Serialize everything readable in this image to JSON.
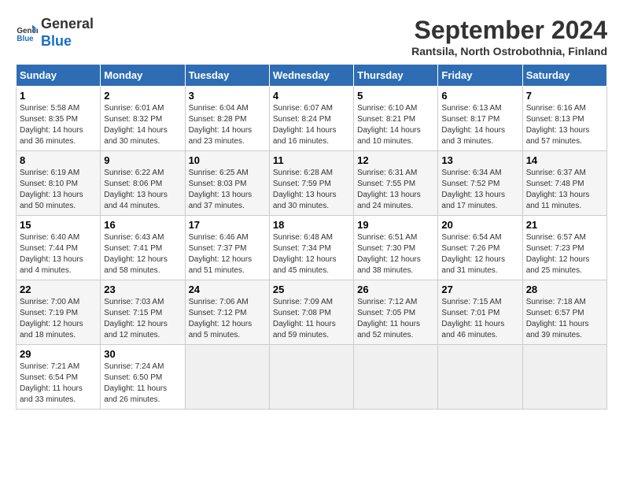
{
  "header": {
    "logo_line1": "General",
    "logo_line2": "Blue",
    "title": "September 2024",
    "subtitle": "Rantsila, North Ostrobothnia, Finland"
  },
  "days_of_week": [
    "Sunday",
    "Monday",
    "Tuesday",
    "Wednesday",
    "Thursday",
    "Friday",
    "Saturday"
  ],
  "weeks": [
    [
      {
        "day": "1",
        "sunrise": "Sunrise: 5:58 AM",
        "sunset": "Sunset: 8:35 PM",
        "daylight": "Daylight: 14 hours and 36 minutes."
      },
      {
        "day": "2",
        "sunrise": "Sunrise: 6:01 AM",
        "sunset": "Sunset: 8:32 PM",
        "daylight": "Daylight: 14 hours and 30 minutes."
      },
      {
        "day": "3",
        "sunrise": "Sunrise: 6:04 AM",
        "sunset": "Sunset: 8:28 PM",
        "daylight": "Daylight: 14 hours and 23 minutes."
      },
      {
        "day": "4",
        "sunrise": "Sunrise: 6:07 AM",
        "sunset": "Sunset: 8:24 PM",
        "daylight": "Daylight: 14 hours and 16 minutes."
      },
      {
        "day": "5",
        "sunrise": "Sunrise: 6:10 AM",
        "sunset": "Sunset: 8:21 PM",
        "daylight": "Daylight: 14 hours and 10 minutes."
      },
      {
        "day": "6",
        "sunrise": "Sunrise: 6:13 AM",
        "sunset": "Sunset: 8:17 PM",
        "daylight": "Daylight: 14 hours and 3 minutes."
      },
      {
        "day": "7",
        "sunrise": "Sunrise: 6:16 AM",
        "sunset": "Sunset: 8:13 PM",
        "daylight": "Daylight: 13 hours and 57 minutes."
      }
    ],
    [
      {
        "day": "8",
        "sunrise": "Sunrise: 6:19 AM",
        "sunset": "Sunset: 8:10 PM",
        "daylight": "Daylight: 13 hours and 50 minutes."
      },
      {
        "day": "9",
        "sunrise": "Sunrise: 6:22 AM",
        "sunset": "Sunset: 8:06 PM",
        "daylight": "Daylight: 13 hours and 44 minutes."
      },
      {
        "day": "10",
        "sunrise": "Sunrise: 6:25 AM",
        "sunset": "Sunset: 8:03 PM",
        "daylight": "Daylight: 13 hours and 37 minutes."
      },
      {
        "day": "11",
        "sunrise": "Sunrise: 6:28 AM",
        "sunset": "Sunset: 7:59 PM",
        "daylight": "Daylight: 13 hours and 30 minutes."
      },
      {
        "day": "12",
        "sunrise": "Sunrise: 6:31 AM",
        "sunset": "Sunset: 7:55 PM",
        "daylight": "Daylight: 13 hours and 24 minutes."
      },
      {
        "day": "13",
        "sunrise": "Sunrise: 6:34 AM",
        "sunset": "Sunset: 7:52 PM",
        "daylight": "Daylight: 13 hours and 17 minutes."
      },
      {
        "day": "14",
        "sunrise": "Sunrise: 6:37 AM",
        "sunset": "Sunset: 7:48 PM",
        "daylight": "Daylight: 13 hours and 11 minutes."
      }
    ],
    [
      {
        "day": "15",
        "sunrise": "Sunrise: 6:40 AM",
        "sunset": "Sunset: 7:44 PM",
        "daylight": "Daylight: 13 hours and 4 minutes."
      },
      {
        "day": "16",
        "sunrise": "Sunrise: 6:43 AM",
        "sunset": "Sunset: 7:41 PM",
        "daylight": "Daylight: 12 hours and 58 minutes."
      },
      {
        "day": "17",
        "sunrise": "Sunrise: 6:46 AM",
        "sunset": "Sunset: 7:37 PM",
        "daylight": "Daylight: 12 hours and 51 minutes."
      },
      {
        "day": "18",
        "sunrise": "Sunrise: 6:48 AM",
        "sunset": "Sunset: 7:34 PM",
        "daylight": "Daylight: 12 hours and 45 minutes."
      },
      {
        "day": "19",
        "sunrise": "Sunrise: 6:51 AM",
        "sunset": "Sunset: 7:30 PM",
        "daylight": "Daylight: 12 hours and 38 minutes."
      },
      {
        "day": "20",
        "sunrise": "Sunrise: 6:54 AM",
        "sunset": "Sunset: 7:26 PM",
        "daylight": "Daylight: 12 hours and 31 minutes."
      },
      {
        "day": "21",
        "sunrise": "Sunrise: 6:57 AM",
        "sunset": "Sunset: 7:23 PM",
        "daylight": "Daylight: 12 hours and 25 minutes."
      }
    ],
    [
      {
        "day": "22",
        "sunrise": "Sunrise: 7:00 AM",
        "sunset": "Sunset: 7:19 PM",
        "daylight": "Daylight: 12 hours and 18 minutes."
      },
      {
        "day": "23",
        "sunrise": "Sunrise: 7:03 AM",
        "sunset": "Sunset: 7:15 PM",
        "daylight": "Daylight: 12 hours and 12 minutes."
      },
      {
        "day": "24",
        "sunrise": "Sunrise: 7:06 AM",
        "sunset": "Sunset: 7:12 PM",
        "daylight": "Daylight: 12 hours and 5 minutes."
      },
      {
        "day": "25",
        "sunrise": "Sunrise: 7:09 AM",
        "sunset": "Sunset: 7:08 PM",
        "daylight": "Daylight: 11 hours and 59 minutes."
      },
      {
        "day": "26",
        "sunrise": "Sunrise: 7:12 AM",
        "sunset": "Sunset: 7:05 PM",
        "daylight": "Daylight: 11 hours and 52 minutes."
      },
      {
        "day": "27",
        "sunrise": "Sunrise: 7:15 AM",
        "sunset": "Sunset: 7:01 PM",
        "daylight": "Daylight: 11 hours and 46 minutes."
      },
      {
        "day": "28",
        "sunrise": "Sunrise: 7:18 AM",
        "sunset": "Sunset: 6:57 PM",
        "daylight": "Daylight: 11 hours and 39 minutes."
      }
    ],
    [
      {
        "day": "29",
        "sunrise": "Sunrise: 7:21 AM",
        "sunset": "Sunset: 6:54 PM",
        "daylight": "Daylight: 11 hours and 33 minutes."
      },
      {
        "day": "30",
        "sunrise": "Sunrise: 7:24 AM",
        "sunset": "Sunset: 6:50 PM",
        "daylight": "Daylight: 11 hours and 26 minutes."
      },
      null,
      null,
      null,
      null,
      null
    ]
  ]
}
